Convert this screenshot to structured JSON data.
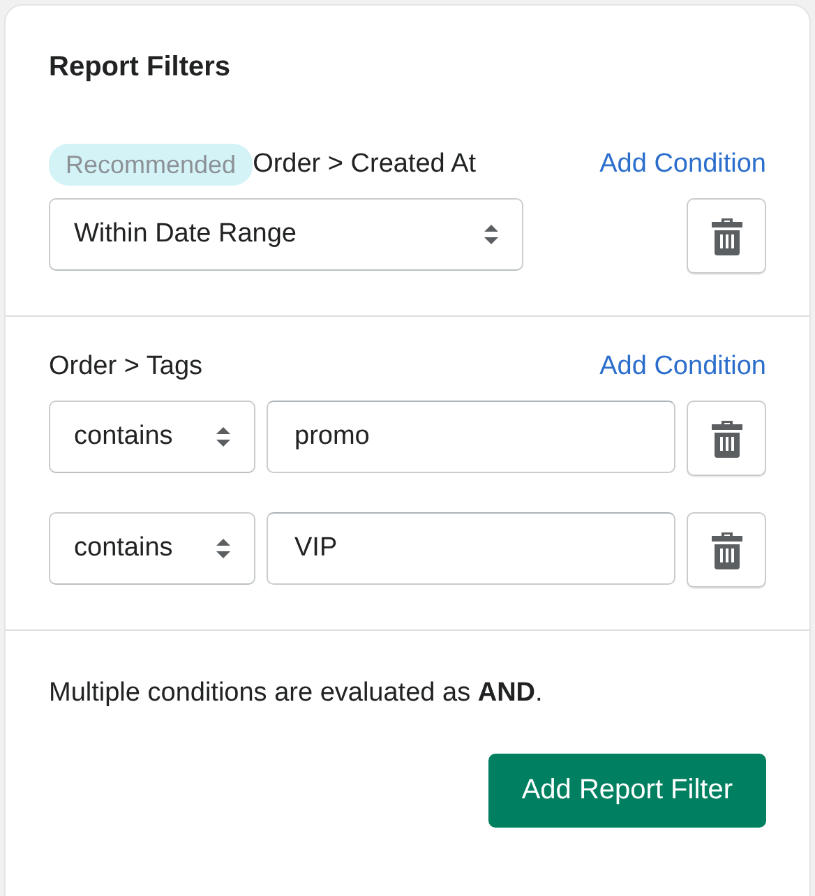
{
  "title": "Report Filters",
  "filters": [
    {
      "badge": "Recommended",
      "field": "Order > Created At",
      "add_label": "Add Condition",
      "conditions": [
        {
          "kind": "select",
          "operator": "Within Date Range"
        }
      ]
    },
    {
      "field": "Order > Tags",
      "add_label": "Add Condition",
      "conditions": [
        {
          "kind": "select-with-value",
          "operator": "contains",
          "value": "promo"
        },
        {
          "kind": "select-with-value",
          "operator": "contains",
          "value": "VIP"
        }
      ]
    }
  ],
  "note": "Multiple conditions are evaluated as **AND**.",
  "submit": "Add Report Filter"
}
